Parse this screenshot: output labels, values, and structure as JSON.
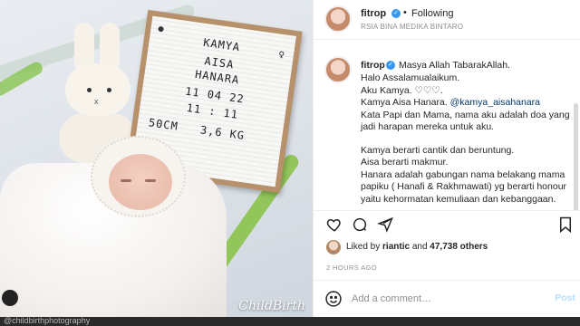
{
  "photo": {
    "board_lines": [
      "KAMYA",
      "AISA",
      "HANARA",
      "11 04 22",
      "11 : 11"
    ],
    "board_measure_left": "50CM",
    "board_measure_right": "3,6 KG",
    "board_symbol": "♀",
    "watermark": "ChildBirth"
  },
  "post_header": {
    "username": "fitrop",
    "separator": "•",
    "follow_state": "Following",
    "location": "RSIA BINA MEDIKA BINTARO"
  },
  "caption": {
    "username": "fitrop",
    "first_line": "Masya Allah TabarakAllah.",
    "lines": [
      "Halo Assalamualaikum.",
      "Aku Kamya. ♡♡♡.",
      "Kamya Aisa Hanara.",
      "Kata Papi dan Mama, nama aku adalah doa yang",
      "jadi harapan mereka untuk aku.",
      "",
      "Kamya berarti cantik dan beruntung.",
      "Aisa berarti makmur.",
      "Hanara adalah gabungan nama belakang mama",
      "papiku ( Hanafi & Rakhmawati) yg berarti honour",
      "yaitu kehormatan kemuliaan dan kebanggaan."
    ],
    "mention": "@kamya_aisahanara"
  },
  "likes": {
    "prefix": "Liked by",
    "user": "riantic",
    "conj": "and",
    "count": "47,738 others"
  },
  "timestamp": "2 HOURS AGO",
  "comment": {
    "placeholder": "Add a comment…",
    "post_label": "Post"
  },
  "bottom_caption": "@childbirthphotography",
  "colors": {
    "verified": "#3897f0",
    "mention": "#00376b",
    "post_disabled": "#b2dffc",
    "muted": "#8e8e8e"
  },
  "icons": {
    "verified": "verified-badge-icon",
    "like": "heart-icon",
    "comment": "comment-icon",
    "share": "paper-plane-icon",
    "save": "bookmark-icon",
    "emoji": "emoji-smile-icon"
  }
}
